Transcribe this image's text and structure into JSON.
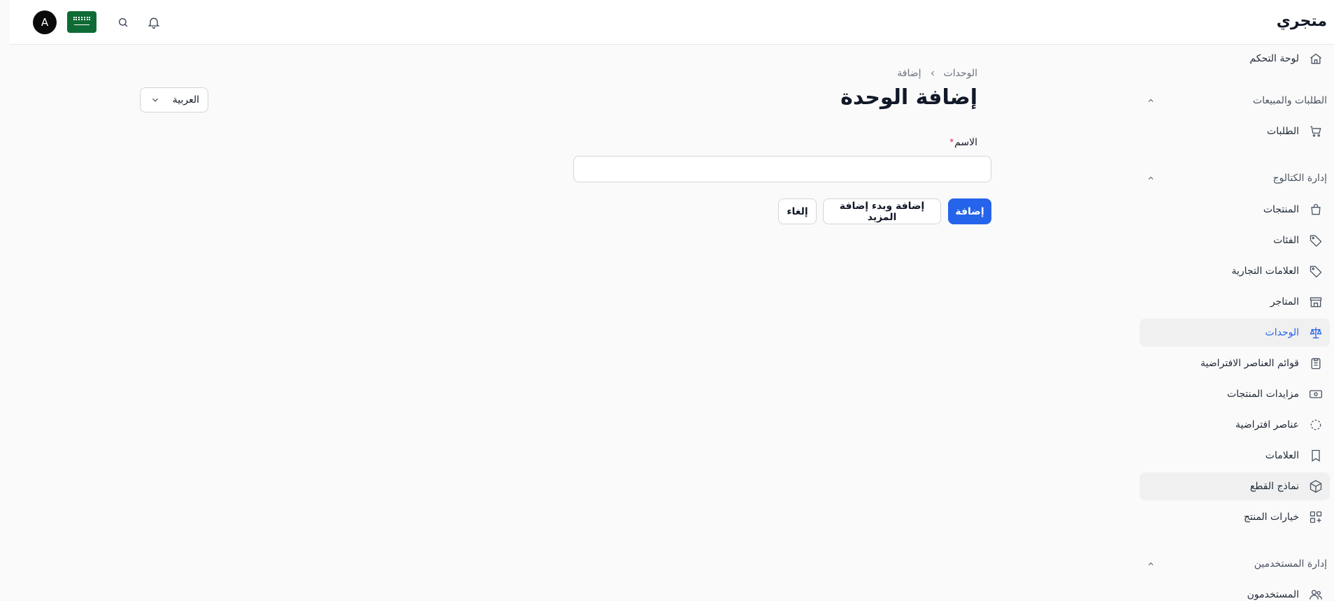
{
  "header": {
    "brand": "متجري",
    "avatar_initial": "A",
    "icons": [
      "bell-icon",
      "search-icon",
      "saudi-flag-icon"
    ]
  },
  "sidebar": {
    "items": [
      {
        "label": "لوحة التحكم",
        "icon": "home-icon"
      },
      {
        "group": "الطلبات والمبيعات"
      },
      {
        "label": "الطلبات",
        "icon": "cart-icon"
      },
      {
        "group": "إدارة الكتالوج"
      },
      {
        "label": "المنتجات",
        "icon": "bag-icon"
      },
      {
        "label": "الفئات",
        "icon": "tag-icon"
      },
      {
        "label": "العلامات التجارية",
        "icon": "tag-icon"
      },
      {
        "label": "المتاجر",
        "icon": "store-icon"
      },
      {
        "label": "الوحدات",
        "icon": "scale-icon",
        "active": true
      },
      {
        "label": "قوائم العناصر الافتراضية",
        "icon": "clipboard-list-icon"
      },
      {
        "label": "مزايدات المنتجات",
        "icon": "banknote-icon"
      },
      {
        "label": "عناصر افتراضية",
        "icon": "dashed-box-icon"
      },
      {
        "label": "العلامات",
        "icon": "bookmark-icon"
      },
      {
        "label": "نماذج القطع",
        "icon": "cube-icon"
      },
      {
        "label": "خيارات المنتج",
        "icon": "grid-plus-icon"
      },
      {
        "group": "إدارة المستخدمين"
      },
      {
        "label": "المستخدمون",
        "icon": "users-icon"
      }
    ],
    "accent": "#2563eb"
  },
  "main": {
    "breadcrumb": [
      "الوحدات",
      "إضافة"
    ],
    "title": "إضافة الوحدة",
    "language_select": "العربية",
    "field": {
      "label": "الاسم",
      "required_mark": "*",
      "value": "",
      "placeholder": ""
    },
    "buttons": {
      "submit": "إضافة",
      "submit_and_more": "إضافة وبدء إضافة المزيد",
      "cancel": "إلغاء"
    }
  }
}
